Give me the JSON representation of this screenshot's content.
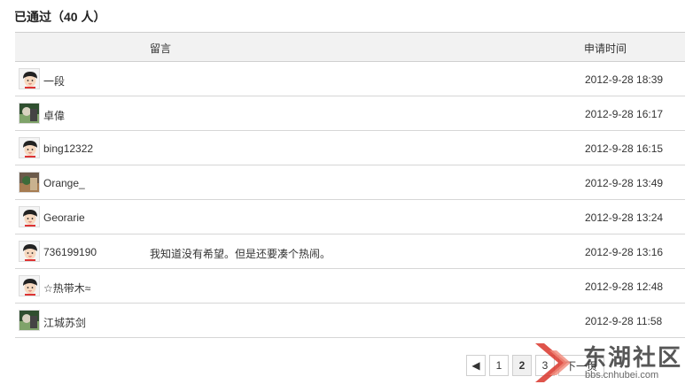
{
  "header": {
    "title": "已通过（40 人）"
  },
  "table": {
    "columns": {
      "message": "留言",
      "time": "申请时间"
    },
    "rows": [
      {
        "name": "一段",
        "message": "",
        "time": "2012-9-28 18:39",
        "avatar": "default-avatar-icon"
      },
      {
        "name": "卓偉",
        "message": "",
        "time": "2012-9-28 16:17",
        "avatar": "photo-avatar-icon"
      },
      {
        "name": "bing12322",
        "message": "",
        "time": "2012-9-28 16:15",
        "avatar": "default-avatar-icon"
      },
      {
        "name": "Orange_",
        "message": "",
        "time": "2012-9-28 13:49",
        "avatar": "photo-avatar-icon"
      },
      {
        "name": "Georarie",
        "message": "",
        "time": "2012-9-28 13:24",
        "avatar": "default-avatar-icon"
      },
      {
        "name": "736199190",
        "message": "我知道没有希望。但是还要凑个热闹。",
        "time": "2012-9-28 13:16",
        "avatar": "default-avatar-icon"
      },
      {
        "name": "☆热带木≈",
        "message": "",
        "time": "2012-9-28 12:48",
        "avatar": "default-avatar-icon"
      },
      {
        "name": "江城苏剑",
        "message": "",
        "time": "2012-9-28 11:58",
        "avatar": "photo-avatar-icon"
      }
    ]
  },
  "pagination": {
    "prev_icon": "arrow-left-icon",
    "pages": [
      "1",
      "2",
      "3"
    ],
    "current": "2",
    "next_label": "下一页"
  },
  "watermark": {
    "text": "东湖社区",
    "url": "bbs.cnhubei.com"
  }
}
